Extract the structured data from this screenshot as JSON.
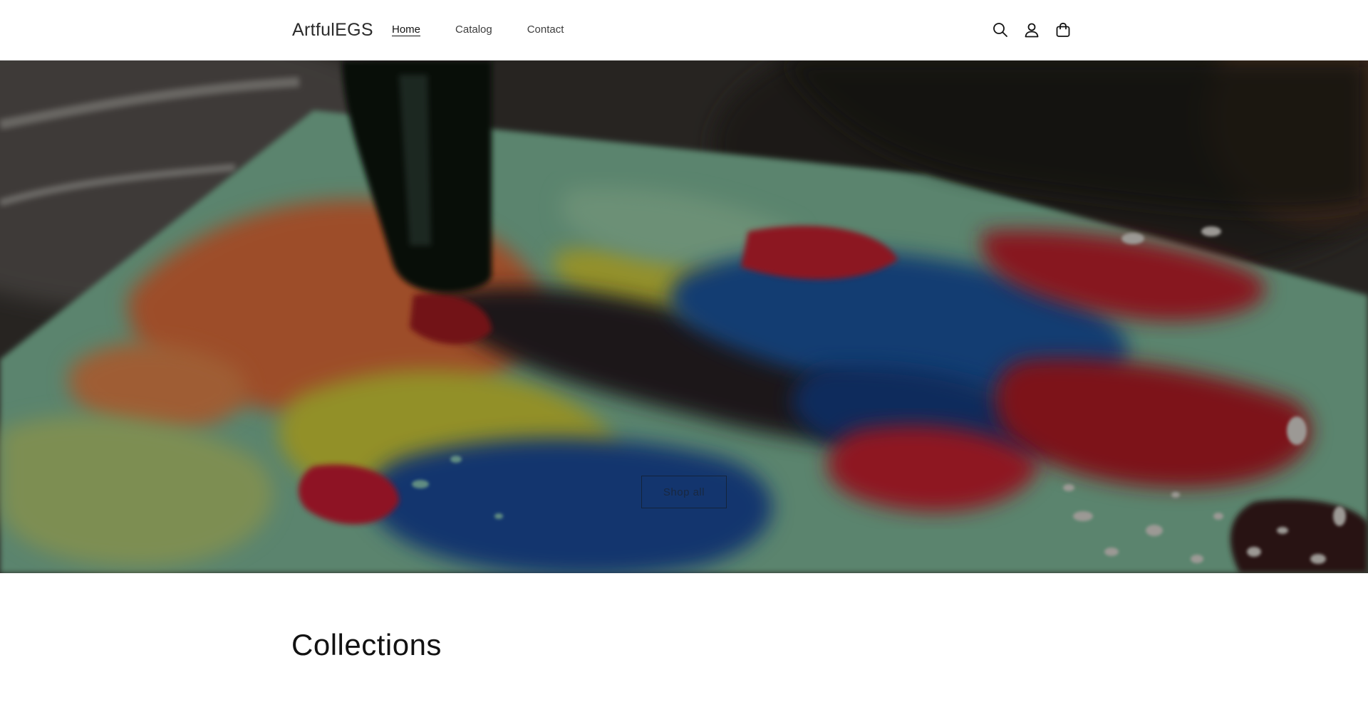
{
  "header": {
    "logo": "ArtfulEGS",
    "nav": [
      {
        "label": "Home",
        "active": true
      },
      {
        "label": "Catalog",
        "active": false
      },
      {
        "label": "Contact",
        "active": false
      }
    ],
    "icons": [
      "search-icon",
      "account-icon",
      "cart-icon"
    ]
  },
  "hero": {
    "image": "abstract-paint-pour-photo",
    "button_label": "Shop all"
  },
  "collections": {
    "title": "Collections"
  },
  "colors": {
    "text": "#121212",
    "background": "#ffffff"
  }
}
